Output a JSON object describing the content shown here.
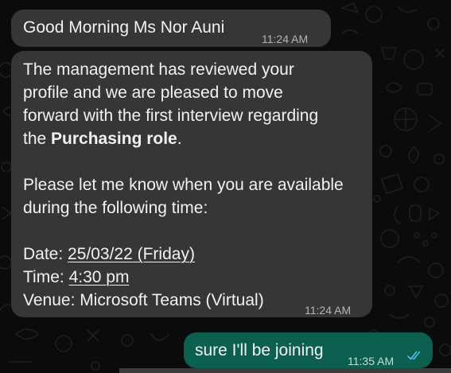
{
  "messages": [
    {
      "direction": "incoming",
      "text": "Good Morning Ms Nor Auni",
      "time": "11:24 AM"
    },
    {
      "direction": "incoming",
      "paragraph1": {
        "line1": "The management has reviewed your",
        "line2": "profile and we are pleased to move",
        "line3": "forward with the first interview regarding",
        "line4_prefix": "the ",
        "line4_bold": "Purchasing role",
        "line4_suffix": "."
      },
      "paragraph2": {
        "line1": "Please let me know when you are available",
        "line2": "during the following time:"
      },
      "details": {
        "date_label": "Date: ",
        "date_value": "25/03/22 (Friday)",
        "time_label": "Time: ",
        "time_value": "4:30 pm",
        "venue_line": "Venue: Microsoft Teams (Virtual)"
      },
      "time": "11:24 AM"
    },
    {
      "direction": "outgoing",
      "text": "sure I'll be joining",
      "time": "11:35 AM",
      "status_icon": "double-check-read-icon"
    }
  ],
  "colors": {
    "background": "#0b0b0b",
    "incoming_bubble": "#363636",
    "outgoing_bubble": "#0b5f4f",
    "read_ticks": "#53bdeb"
  }
}
